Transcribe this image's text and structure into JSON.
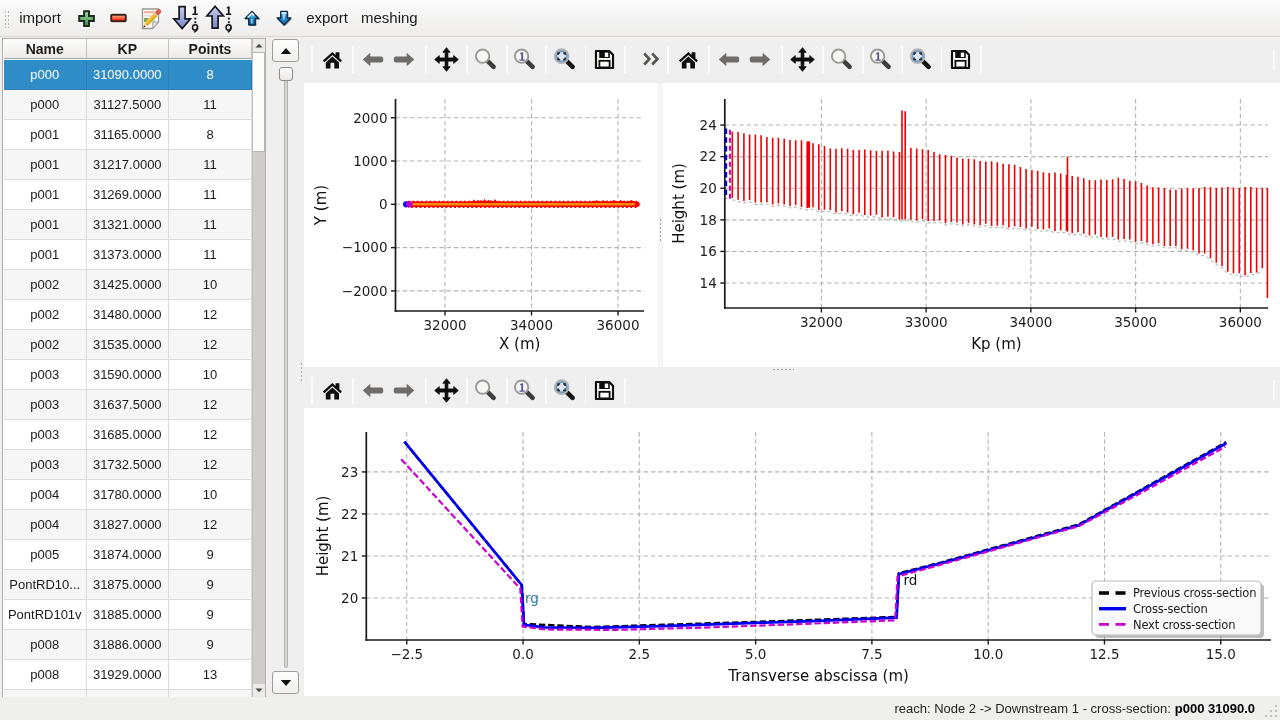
{
  "app": {
    "background": "#efefef",
    "accent": "#308cc6"
  },
  "toolbar": {
    "import_label": "import",
    "export_label": "export",
    "meshing_label": "meshing",
    "icons": [
      "add-icon",
      "remove-icon",
      "edit-icon",
      "sort-descending-icon",
      "sort-ascending-icon",
      "move-up-icon",
      "move-down-icon"
    ]
  },
  "table": {
    "columns": [
      "Name",
      "KP",
      "Points"
    ],
    "selected_row": 0,
    "rows": [
      [
        "p000",
        "31090.0000",
        "8"
      ],
      [
        "p000",
        "31127.5000",
        "11"
      ],
      [
        "p001",
        "31165.0000",
        "8"
      ],
      [
        "p001",
        "31217.0000",
        "11"
      ],
      [
        "p001",
        "31269.0000",
        "11"
      ],
      [
        "p001",
        "31321.0000",
        "11"
      ],
      [
        "p001",
        "31373.0000",
        "11"
      ],
      [
        "p002",
        "31425.0000",
        "10"
      ],
      [
        "p002",
        "31480.0000",
        "12"
      ],
      [
        "p002",
        "31535.0000",
        "12"
      ],
      [
        "p003",
        "31590.0000",
        "10"
      ],
      [
        "p003",
        "31637.5000",
        "12"
      ],
      [
        "p003",
        "31685.0000",
        "12"
      ],
      [
        "p003",
        "31732.5000",
        "12"
      ],
      [
        "p004",
        "31780.0000",
        "10"
      ],
      [
        "p004",
        "31827.0000",
        "12"
      ],
      [
        "p005",
        "31874.0000",
        "9"
      ],
      [
        "PontRD10...",
        "31875.0000",
        "9"
      ],
      [
        "PontRD101v",
        "31885.0000",
        "9"
      ],
      [
        "p008",
        "31886.0000",
        "9"
      ],
      [
        "p008",
        "31929.0000",
        "13"
      ]
    ]
  },
  "nav_toolbars": {
    "items": [
      "home",
      "back",
      "forward",
      "pan",
      "zoom",
      "zoom-one",
      "zoom-fit",
      "save"
    ],
    "overflow_label": "»"
  },
  "status_bar": {
    "reach_label": "reach: Node 2 -> Downstream 1 - cross-section: ",
    "current_value": "p000 31090.0"
  },
  "chart_data": [
    {
      "id": "xy",
      "type": "scatter",
      "title": "",
      "xlabel": "X (m)",
      "ylabel": "Y (m)",
      "xlim": [
        30855,
        36601
      ],
      "ylim": [
        -2464,
        2432
      ],
      "xticks": [
        32000,
        34000,
        36000
      ],
      "xtick_labels": [
        "32000",
        "34000",
        "36000"
      ],
      "yticks": [
        -2000,
        -1000,
        0,
        1000,
        2000
      ],
      "ytick_labels": [
        "−2000",
        "−1000",
        "0",
        "1000",
        "2000"
      ],
      "grid": true,
      "line": {
        "x_start": 31098,
        "x_end": 36439,
        "y": 0,
        "color": "#f80000",
        "core_color": "#ff8c00"
      },
      "markers": [
        {
          "x": 31100,
          "y": 0,
          "color": "#1c13ee",
          "name": "current-point"
        },
        {
          "x": 31180,
          "y": 0,
          "color": "#bb00c8",
          "name": "next-point"
        }
      ]
    },
    {
      "id": "profile",
      "type": "vbars",
      "title": "",
      "xlabel": "Kp (m)",
      "ylabel": "Height (m)",
      "xlim": [
        31078,
        36264
      ],
      "ylim": [
        12.42,
        25.65
      ],
      "xticks": [
        32000,
        33000,
        34000,
        35000,
        36000
      ],
      "xtick_labels": [
        "32000",
        "33000",
        "34000",
        "35000",
        "36000"
      ],
      "yticks": [
        14,
        16,
        18,
        20,
        22,
        24
      ],
      "ytick_labels": [
        "14",
        "16",
        "18",
        "20",
        "22",
        "24"
      ],
      "grid": true,
      "bar_color": "#f00000",
      "envelope_color": "#bcbcbc",
      "envelope_exclude_kp": [
        36258
      ],
      "current": {
        "kp": 31090,
        "bottom": 19.33,
        "top": 23.78,
        "color": "#0000ee"
      },
      "next": {
        "kp": 31127.5,
        "bottom": 19.28,
        "top": 23.7,
        "color": "#cc00cc"
      },
      "bars": [
        [
          31150,
          19.39,
          23.58
        ],
        [
          31205,
          19.27,
          23.57
        ],
        [
          31260,
          19.19,
          23.48
        ],
        [
          31315,
          19.26,
          23.4
        ],
        [
          31370,
          19.1,
          23.4
        ],
        [
          31425,
          19.1,
          23.35
        ],
        [
          31480,
          19.12,
          23.25
        ],
        [
          31535,
          18.97,
          23.2
        ],
        [
          31590,
          19.04,
          23.2
        ],
        [
          31645,
          18.98,
          23.14
        ],
        [
          31700,
          18.87,
          23.05
        ],
        [
          31755,
          18.94,
          23.04
        ],
        [
          31810,
          18.81,
          23.04
        ],
        [
          31865,
          18.75,
          22.96
        ],
        [
          31875.0,
          18.78,
          22.97
        ],
        [
          31885.0,
          18.77,
          22.96
        ],
        [
          31920,
          18.8,
          22.85
        ],
        [
          31975,
          18.63,
          22.78
        ],
        [
          32030,
          18.64,
          22.67
        ],
        [
          32085,
          18.63,
          22.52
        ],
        [
          32140,
          18.47,
          22.5
        ],
        [
          32195,
          18.54,
          22.53
        ],
        [
          32250,
          18.47,
          22.5
        ],
        [
          32305,
          18.36,
          22.43
        ],
        [
          32360,
          18.45,
          22.43
        ],
        [
          32415,
          18.31,
          22.45
        ],
        [
          32470,
          18.28,
          22.4
        ],
        [
          32525,
          18.32,
          22.35
        ],
        [
          32580,
          18.15,
          22.38
        ],
        [
          32635,
          18.19,
          22.39
        ],
        [
          32690,
          18.17,
          22.33
        ],
        [
          32745,
          18.01,
          22.3
        ],
        [
          32770.0,
          18.06,
          24.92
        ],
        [
          32800.0,
          18.03,
          24.88
        ],
        [
          32800,
          18.07,
          22.46
        ],
        [
          32855,
          18.01,
          22.54
        ],
        [
          32910,
          17.95,
          22.52
        ],
        [
          32965,
          18.06,
          22.47
        ],
        [
          33020,
          17.92,
          22.43
        ],
        [
          33075,
          17.92,
          22.3
        ],
        [
          33130,
          17.96,
          22.15
        ],
        [
          33185,
          17.79,
          22.11
        ],
        [
          33240,
          17.86,
          22.06
        ],
        [
          33295,
          17.83,
          21.95
        ],
        [
          33350,
          17.71,
          21.87
        ],
        [
          33405,
          17.81,
          21.87
        ],
        [
          33460,
          17.71,
          21.83
        ],
        [
          33515,
          17.66,
          21.73
        ],
        [
          33570,
          17.75,
          21.7
        ],
        [
          33625,
          17.61,
          21.71
        ],
        [
          33680,
          17.63,
          21.65
        ],
        [
          33735,
          17.66,
          21.55
        ],
        [
          33790,
          17.51,
          21.52
        ],
        [
          33845,
          17.59,
          21.49
        ],
        [
          33900,
          17.55,
          21.34
        ],
        [
          33955,
          17.45,
          21.21
        ],
        [
          34010,
          17.56,
          21.15
        ],
        [
          34065,
          17.43,
          21.11
        ],
        [
          34120,
          17.39,
          21.01
        ],
        [
          34175,
          17.45,
          20.96
        ],
        [
          34230,
          17.29,
          20.99
        ],
        [
          34285,
          17.32,
          20.94
        ],
        [
          34340,
          17.31,
          20.83
        ],
        [
          34350.0,
          17.25,
          22.0
        ],
        [
          34395,
          17.15,
          20.77
        ],
        [
          34450,
          17.22,
          20.73
        ],
        [
          34505,
          17.12,
          20.63
        ],
        [
          34560,
          17.0,
          20.52
        ],
        [
          34615,
          17.08,
          20.51
        ],
        [
          34670,
          16.92,
          20.56
        ],
        [
          34725,
          16.89,
          20.52
        ],
        [
          34780,
          16.93,
          20.57
        ],
        [
          34835,
          16.75,
          20.67
        ],
        [
          34890,
          16.79,
          20.59
        ],
        [
          34945,
          16.75,
          20.47
        ],
        [
          35000,
          16.6,
          20.44
        ],
        [
          35055,
          16.67,
          20.34
        ],
        [
          35110,
          16.55,
          20.17
        ],
        [
          35165,
          16.46,
          20.06
        ],
        [
          35220,
          16.52,
          20.04
        ],
        [
          35275,
          16.35,
          20.02
        ],
        [
          35330,
          16.34,
          19.92
        ],
        [
          35385,
          16.35,
          19.9
        ],
        [
          35440,
          16.15,
          19.98
        ],
        [
          35495,
          16.17,
          20.0
        ],
        [
          35550,
          16.07,
          19.98
        ],
        [
          35605,
          15.87,
          20.01
        ],
        [
          35660,
          15.87,
          20.08
        ],
        [
          35715,
          15.57,
          20.06
        ],
        [
          35770,
          15.29,
          20.02
        ],
        [
          35825,
          15.07,
          20.05
        ],
        [
          35880,
          14.72,
          20.08
        ],
        [
          35935,
          14.62,
          20.04
        ],
        [
          35990,
          14.62,
          20.02
        ],
        [
          36045,
          14.48,
          20.07
        ],
        [
          36100,
          14.63,
          20.08
        ],
        [
          36155,
          14.66,
          20.03
        ],
        [
          36210,
          14.93,
          20.03
        ],
        [
          36258.0,
          13.05,
          20.02
        ]
      ]
    },
    {
      "id": "cross_section",
      "type": "line",
      "title": "",
      "xlabel": "Transverse abscissa (m)",
      "ylabel": "Height (m)",
      "xlim": [
        -3.37,
        16.08
      ],
      "ylim": [
        19.0,
        23.95
      ],
      "xticks": [
        -2.5,
        0.0,
        2.5,
        5.0,
        7.5,
        10.0,
        12.5,
        15.0
      ],
      "xtick_labels": [
        "−2.5",
        "0.0",
        "2.5",
        "5.0",
        "7.5",
        "10.0",
        "12.5",
        "15.0"
      ],
      "yticks": [
        20,
        21,
        22,
        23
      ],
      "ytick_labels": [
        "20",
        "21",
        "22",
        "23"
      ],
      "grid": true,
      "series": [
        {
          "name": "Previous cross-section",
          "color": "#000000",
          "style": "dashed",
          "width": 2.4,
          "points": [
            [
              -2.55,
              23.72
            ],
            [
              -0.03,
              20.31
            ],
            [
              0.02,
              19.38
            ],
            [
              1.5,
              19.31
            ],
            [
              5.0,
              19.43
            ],
            [
              8.03,
              19.55
            ],
            [
              8.08,
              20.59
            ],
            [
              9.0,
              20.85
            ],
            [
              11.95,
              21.75
            ],
            [
              15.12,
              23.71
            ]
          ]
        },
        {
          "name": "Cross-section",
          "color": "#0000f0",
          "style": "solid",
          "width": 2.7,
          "points": [
            [
              -2.55,
              23.72
            ],
            [
              -0.03,
              20.31
            ],
            [
              0.02,
              19.36
            ],
            [
              0.45,
              19.3
            ],
            [
              1.5,
              19.29
            ],
            [
              3.0,
              19.33
            ],
            [
              5.0,
              19.41
            ],
            [
              6.5,
              19.46
            ],
            [
              8.03,
              19.53
            ],
            [
              8.08,
              20.57
            ],
            [
              9.0,
              20.83
            ],
            [
              11.95,
              21.73
            ],
            [
              15.12,
              23.68
            ]
          ]
        },
        {
          "name": "Next cross-section",
          "color": "#cc00cc",
          "style": "dashed",
          "width": 2.2,
          "points": [
            [
              -2.62,
              23.3
            ],
            [
              -0.06,
              20.22
            ],
            [
              -0.01,
              19.32
            ],
            [
              0.5,
              19.25
            ],
            [
              2.0,
              19.24
            ],
            [
              4.0,
              19.3
            ],
            [
              6.0,
              19.38
            ],
            [
              8.0,
              19.47
            ],
            [
              8.05,
              20.51
            ],
            [
              9.0,
              20.8
            ],
            [
              11.95,
              21.71
            ],
            [
              13.5,
              22.63
            ],
            [
              15.1,
              23.6
            ]
          ]
        }
      ],
      "annotations": [
        {
          "text": "rg",
          "x": 0.04,
          "y": 19.88,
          "color": "#2e7bab",
          "name": "left-bank-label"
        },
        {
          "text": "rd",
          "x": 8.18,
          "y": 20.3,
          "color": "#111111",
          "name": "right-bank-label"
        }
      ],
      "legend": {
        "entries": [
          "Previous cross-section",
          "Cross-section",
          "Next cross-section"
        ],
        "position": "lower right"
      }
    }
  ]
}
